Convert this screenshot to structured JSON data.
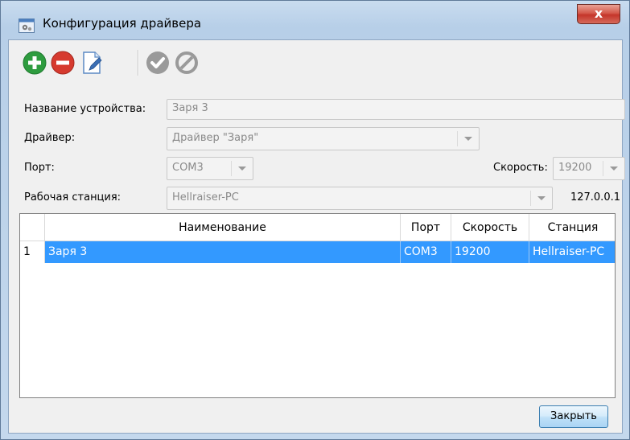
{
  "window": {
    "title": "Конфигурация драйвера",
    "close_symbol": "x"
  },
  "toolbar": {
    "buttons": [
      {
        "icon": "add-icon",
        "enabled": true
      },
      {
        "icon": "remove-icon",
        "enabled": true
      },
      {
        "icon": "edit-icon",
        "enabled": true
      },
      {
        "icon": "accept-icon",
        "enabled": false
      },
      {
        "icon": "cancel-icon",
        "enabled": false
      }
    ]
  },
  "form": {
    "device_name_label": "Название устройства:",
    "device_name_value": "Заря 3",
    "driver_label": "Драйвер:",
    "driver_value": "Драйвер \"Заря\"",
    "port_label": "Порт:",
    "port_value": "COM3",
    "speed_label": "Скорость:",
    "speed_value": "19200",
    "station_label": "Рабочая станция:",
    "station_value": "Hellraiser-PC",
    "ip_address": "127.0.0.1"
  },
  "table": {
    "columns": [
      "Наименование",
      "Порт",
      "Скорость",
      "Станция"
    ],
    "rows": [
      {
        "num": "1",
        "name": "Заря 3",
        "port": "COM3",
        "speed": "19200",
        "station": "Hellraiser-PC",
        "selected": true
      }
    ]
  },
  "footer": {
    "close_label": "Закрыть"
  },
  "colors": {
    "selection": "#3399ff",
    "add_green": "#2e9c3f",
    "remove_red": "#d63a2f",
    "disabled_gray": "#9a9a9a"
  }
}
